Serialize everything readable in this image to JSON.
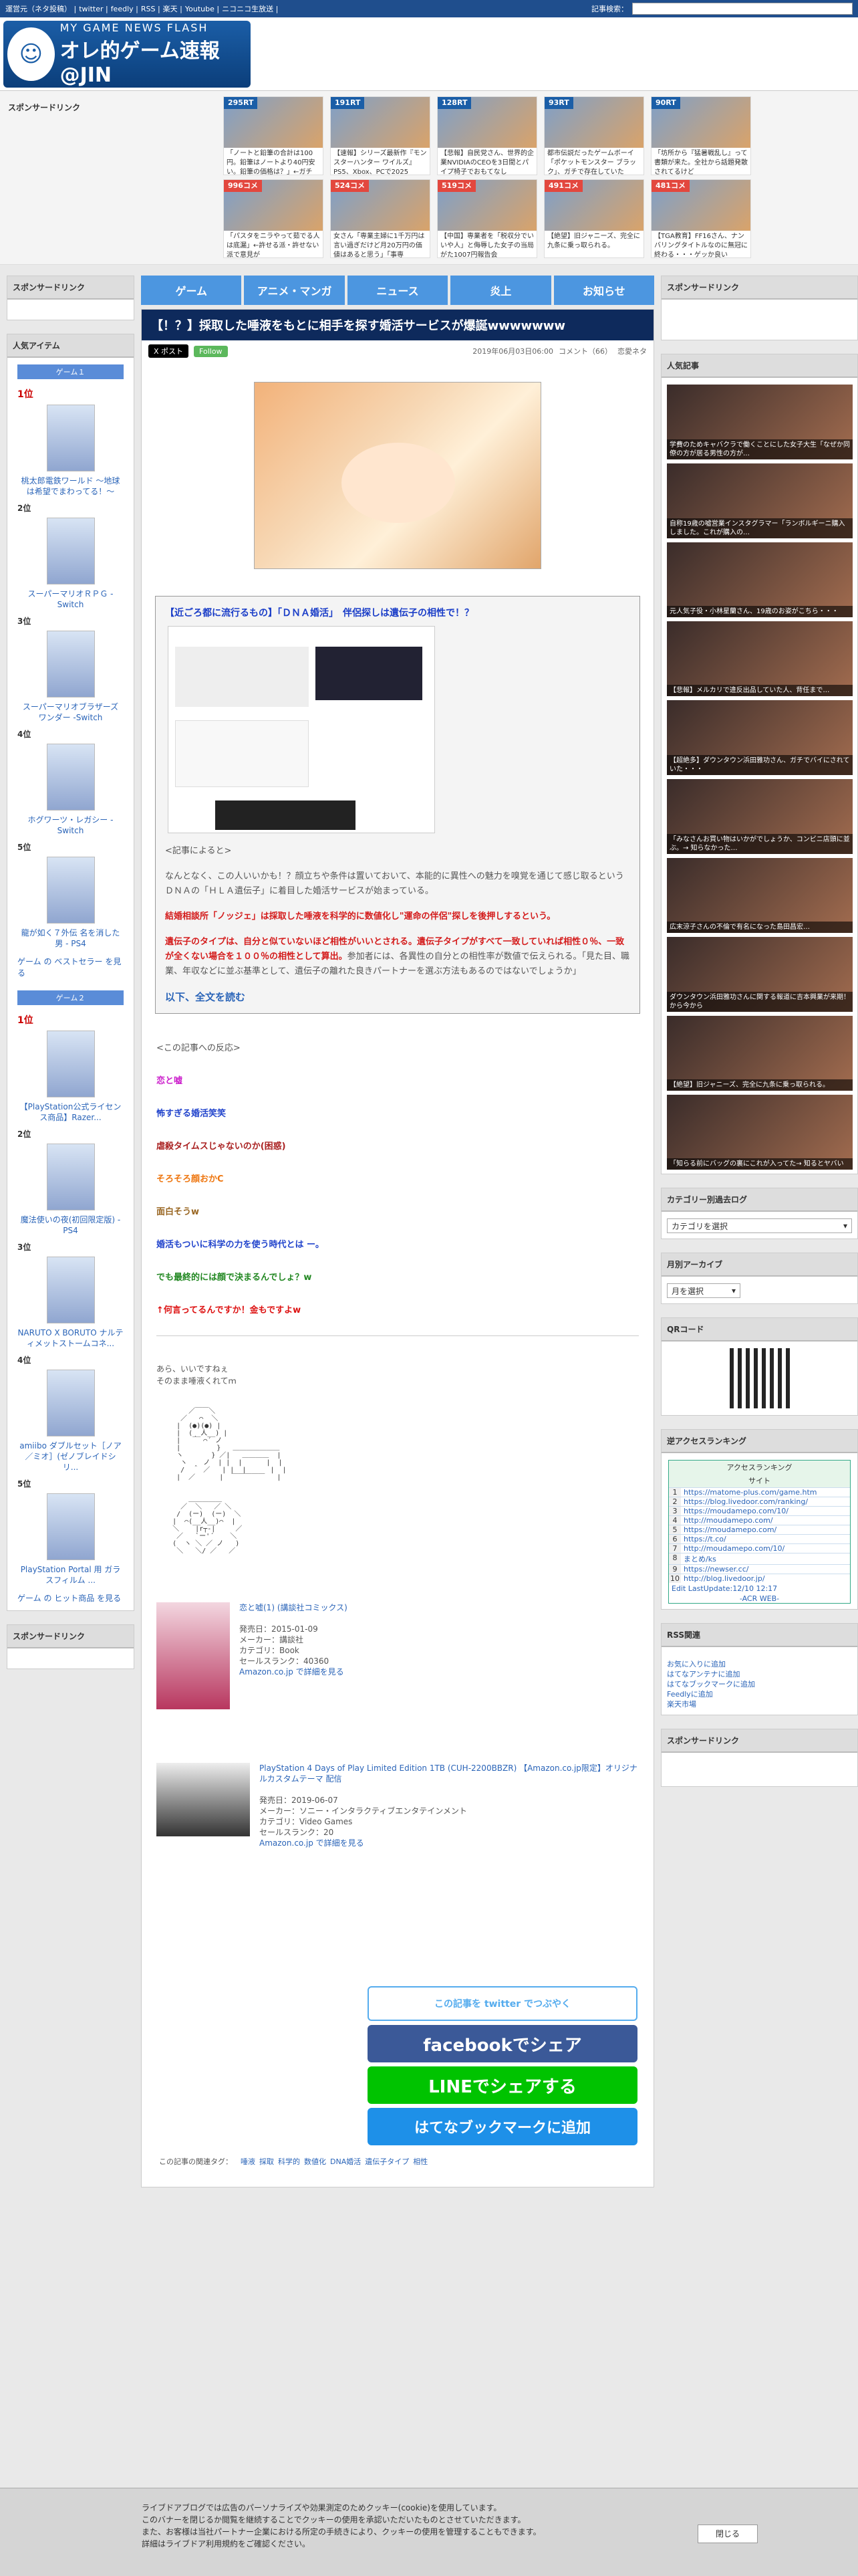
{
  "topbar": {
    "links": [
      "運営元（ネタ投稿）",
      "twitter",
      "feedly",
      "RSS",
      "楽天",
      "Youtube",
      "ニコニコ生放送"
    ],
    "search_label": "記事検索："
  },
  "logo": {
    "line1": "MY GAME NEWS FLASH",
    "line2": "オレ的ゲーム速報@JIN"
  },
  "feed": {
    "label": "スポンサードリンク",
    "items": [
      {
        "badge": "295RT",
        "text": "「ノートと鉛筆の合計は100円。鉛筆はノートより40円安い。鉛筆の価格は？」←ガチ"
      },
      {
        "badge": "191RT",
        "text": "【速報】シリーズ最新作『モンスターハンター ワイルズ』PS5、Xbox、PCで2025"
      },
      {
        "badge": "128RT",
        "text": "【悲報】自民党さん、世界的企業NVIDIAのCEOを3日間とパイプ椅子でおもてなし"
      },
      {
        "badge": "93RT",
        "text": "都市伝説だったゲームボーイ「ポケットモンスター ブラック」、ガチで存在していた"
      },
      {
        "badge": "90RT",
        "text": "「坊所から『猛暑戦乱し』って書類が来た。全社から話題発散されてるけど"
      },
      {
        "badge": "996コメ",
        "text": "「パスタをニラやって茹でる人は底漏」←許せる派・許せない派で意見が"
      },
      {
        "badge": "524コメ",
        "text": "女さん「専業主婦に1千万円は言い過ぎだけど月20万円の価値はあると思う」「事専"
      },
      {
        "badge": "519コメ",
        "text": "【中国】専業者を「税収分でいいや人」と侮辱した女子の当局がた1007円報告会"
      },
      {
        "badge": "491コメ",
        "text": "【絶望】旧ジャニーズ、完全に九条に乗っ取られる。"
      },
      {
        "badge": "481コメ",
        "text": "【TGA教育】FF16さん、ナンバリングタイトルなのに無冠に終わる・・・ゲッか良い"
      }
    ]
  },
  "left": {
    "sponsor": "スポンサードリンク",
    "popular": "人気アイテム",
    "game1": "ゲーム１",
    "game1_items": [
      {
        "rank": "1位",
        "name": "桃太郎電鉄ワールド ～地球は希望でまわってる！～"
      },
      {
        "rank": "2位",
        "name": "スーパーマリオＲＰＧ -Switch"
      },
      {
        "rank": "3位",
        "name": "スーパーマリオブラザーズ ワンダー -Switch"
      },
      {
        "rank": "4位",
        "name": "ホグワーツ・レガシー - Switch"
      },
      {
        "rank": "5位",
        "name": "龍が如く７外伝 名を消した男 - PS4"
      }
    ],
    "game1_more": "ゲーム の ベストセラー を見る",
    "game2": "ゲーム２",
    "game2_items": [
      {
        "rank": "1位",
        "name": "【PlayStation公式ライセンス商品】Razer..."
      },
      {
        "rank": "2位",
        "name": "魔法使いの夜(初回限定版) - PS4"
      },
      {
        "rank": "3位",
        "name": "NARUTO X BORUTO ナルティメットストームコネ..."
      },
      {
        "rank": "4位",
        "name": "amiibo ダブルセット［ノア／ミオ］(ゼノブレイドシリ..."
      },
      {
        "rank": "5位",
        "name": "PlayStation Portal 用 ガラスフィルム ..."
      }
    ],
    "game2_more": "ゲーム の ヒット商品 を見る",
    "sponsor2": "スポンサードリンク"
  },
  "nav": [
    "ゲーム",
    "アニメ・マンガ",
    "ニュース",
    "炎上",
    "お知らせ"
  ],
  "article": {
    "title": "【！？】採取した唾液をもとに相手を探す婚活サービスが爆誕wwwwwww",
    "x": "X ポスト",
    "follow": "Follow",
    "date": "2019年06月03日06:00",
    "comments": "コメント（66）",
    "category": "恋愛ネタ",
    "quote_title": "【近ごろ都に流行るもの】「ＤＮＡ婚活」　伴侶探しは遺伝子の相性で！？",
    "source_label": "<記事によると>",
    "p1": "なんとなく、この人いいかも！？顔立ちや条件は置いておいて、本能的に異性への魅力を嗅覚を通じて感じ取るというＤＮＡの「ＨＬＡ遺伝子」に着目した婚活サービスが始まっている。",
    "p2": "結婚相談所「ノッジェ」は採取した唾液を科学的に数値化し\"運命の伴侶\"探しを後押しするという。",
    "p3_red": "遺伝子のタイプは、自分と似ていないほど相性がいいとされる。遺伝子タイプがすべて一致していれば相性０％、一致が全くない場合を１００％の相性として算出。",
    "p3_rest": "参加者には、各異性の自分との相性率が数値で伝えられる。「見た目、職業、年収などに並ぶ基準として、遺伝子の離れた良きパートナーを選ぶ方法もあるのではないでしょうか」",
    "readmore": "以下、全文を読む",
    "reactions_head": "<この記事への反応>",
    "reactions": [
      {
        "text": "恋と嘘",
        "color": "#cc22cc"
      },
      {
        "text": "怖すぎる婚活笑笑",
        "color": "#2244cc"
      },
      {
        "text": "虐殺タイムスじゃないのか(困惑)",
        "color": "#aa2222"
      },
      {
        "text": "そろそろ顔おかC",
        "color": "#ee7711"
      },
      {
        "text": "面白そうw",
        "color": "#996622"
      },
      {
        "text": "婚活もついに科学の力を使う時代とは ー。",
        "color": "#2244cc"
      },
      {
        "text": "でも最終的には顔で決まるんでしょ？w",
        "color": "#228822"
      },
      {
        "text": "↑何言ってるんですか！金もですよw",
        "color": "#dd1111"
      }
    ],
    "aa_line1": "あら、いいですねぇ",
    "aa_line2": "そのまま唾液くれてｍ",
    "product1": {
      "title": "恋と嘘(1) (講談社コミックス)",
      "date": "発売日：2015-01-09",
      "maker": "メーカー：講談社",
      "category": "カテゴリ：Book",
      "rank": "セールスランク：40360",
      "link": "Amazon.co.jp で詳細を見る"
    },
    "product2": {
      "title": "PlayStation 4 Days of Play Limited Edition 1TB (CUH-2200BBZR) 【Amazon.co.jp限定】オリジナルカスタムテーマ 配信",
      "date": "発売日：2019-06-07",
      "maker": "メーカー：ソニー・インタラクティブエンタテインメント",
      "category": "カテゴリ：Video Games",
      "rank": "セールスランク：20",
      "link": "Amazon.co.jp で詳細を見る"
    },
    "share": {
      "twitter": "この記事を twitter でつぶやく",
      "facebook": "facebookでシェア",
      "line": "LINEでシェアする",
      "hatena": "はてなブックマークに追加"
    },
    "tags_label": "この記事の関連タグ：",
    "tags": [
      "唾液",
      "採取",
      "科学的",
      "数値化",
      "DNA婚活",
      "遺伝子タイプ",
      "相性"
    ]
  },
  "right": {
    "sponsor": "スポンサードリンク",
    "popular": "人気記事",
    "thumbs": [
      "学費のためキャバクラで働くことにした女子大生「なぜか同僚の方が居る男性の方が…",
      "自称19歳の嘘営業インスタグラマー「ランボルギーニ購入しました。これが購入の…",
      "元人気子役・小林星蘭さん、19歳のお姿がこちら・・・",
      "【悲報】メルカリで違反出品していた人、背任まで…",
      "【超絶多】ダウンタウン浜田雅功さん、ガチでバイにされていた・・・",
      "「みなさんお買い物はいかがでしょうか、コンビニ店頭に並ぶ。→ 知らなかった…",
      "広末涼子さんの不倫で有名になった島田昌宏…",
      "ダウンタウン浜田雅功さんに関する報道に吉本興業が来期！ から今から",
      "【絶望】旧ジャニーズ、完全に九条に乗っ取られる。",
      "「知らる前にバッグの裏にこれが入ってた→ 知るとヤバい"
    ],
    "category_label": "カテゴリー別過去ログ",
    "category_select": "カテゴリを選択",
    "monthly_label": "月別アーカイブ",
    "monthly_select": "月を選択",
    "qr_label": "QRコード",
    "access_label": "逆アクセスランキング",
    "access_head": "アクセスランキング",
    "access_site": "サイト",
    "access_rows": [
      "https://matome-plus.com/game.htm",
      "https://blog.livedoor.com/ranking/",
      "https://moudamepo.com/10/",
      "http://moudamepo.com/",
      "https://moudamepo.com/",
      "https://t.co/",
      "http://moudamepo.com/10/",
      "まとめ/ks",
      "https://newser.cc/",
      "http://blog.livedoor.jp/"
    ],
    "access_footer": "Edit LastUpdate:12/10 12:17",
    "access_pr": "-ACR WEB-",
    "rss_label": "RSS関連",
    "rss_links": [
      "お気に入りに追加",
      "はてなアンテナに追加",
      "はてなブックマークに追加",
      "Feedlyに追加",
      "楽天市場"
    ],
    "sponsor2": "スポンサードリンク"
  },
  "cookie": {
    "l1": "ライブドアブログでは広告のパーソナライズや効果測定のためクッキー(cookie)を使用しています。",
    "l2": "このバナーを閉じるか閲覧を継続することでクッキーの使用を承認いただいたものとさせていただきます。",
    "l3": "また、お客様は当社パートナー企業における所定の手続きにより、クッキーの使用を管理することもできます。",
    "l4": "詳細はライブドア利用規約をご確認ください。",
    "close": "閉じる"
  }
}
